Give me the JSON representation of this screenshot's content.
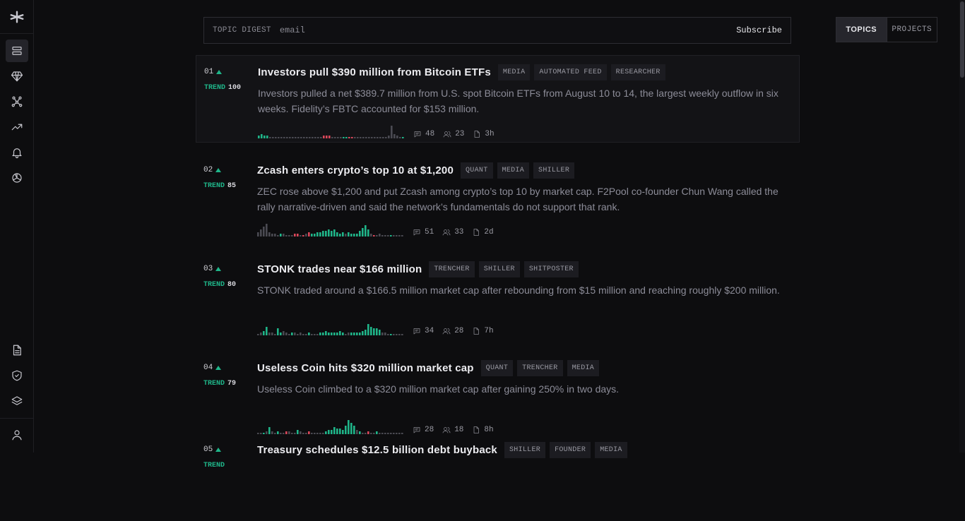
{
  "digest": {
    "label": "TOPIC DIGEST",
    "placeholder": "email",
    "button": "Subscribe"
  },
  "view_toggle": {
    "active": "TOPICS",
    "inactive": "PROJECTS"
  },
  "sidebar": {
    "top_icons": [
      "logo-icon",
      "feed-icon",
      "diamond-icon",
      "network-icon",
      "trending-icon",
      "bell-icon",
      "ai-icon"
    ],
    "bottom_icons": [
      "document-icon",
      "shield-icon",
      "layers-icon",
      "user-icon"
    ]
  },
  "topics": [
    {
      "rank": "01",
      "trend_label": "TREND",
      "trend": "100",
      "title": "Investors pull $390 million from Bitcoin ETFs",
      "tags": [
        "MEDIA",
        "AUTOMATED FEED",
        "RESEARCHER"
      ],
      "description": "Investors pulled a net $389.7 million from U.S. spot Bitcoin ETFs from August 10 to 14, the largest weekly outflow in six weeks. Fidelity’s FBTC accounted for $153 million.",
      "comments": "48",
      "users": "23",
      "age": "3h",
      "spark": [
        2,
        3,
        2,
        2,
        1,
        1,
        1,
        1,
        1,
        1,
        1,
        1,
        1,
        1,
        1,
        1,
        1,
        1,
        1,
        1,
        1,
        1,
        1,
        2,
        2,
        2,
        1,
        1,
        1,
        1,
        1,
        1,
        1,
        1,
        1,
        1,
        1,
        1,
        1,
        1,
        1,
        1,
        1,
        1,
        1,
        1,
        2,
        9,
        3,
        2,
        1,
        1
      ],
      "spark_color": [
        "g",
        "g",
        "g",
        "g",
        "n",
        "n",
        "n",
        "n",
        "n",
        "n",
        "n",
        "n",
        "n",
        "n",
        "n",
        "n",
        "n",
        "n",
        "n",
        "n",
        "n",
        "n",
        "n",
        "r",
        "r",
        "r",
        "n",
        "n",
        "n",
        "n",
        "g",
        "g",
        "r",
        "r",
        "n",
        "n",
        "n",
        "n",
        "n",
        "n",
        "n",
        "n",
        "n",
        "n",
        "n",
        "n",
        "n",
        "n",
        "n",
        "n",
        "n",
        "g"
      ]
    },
    {
      "rank": "02",
      "trend_label": "TREND",
      "trend": "85",
      "title": "Zcash enters crypto’s top 10 at $1,200",
      "tags": [
        "QUANT",
        "MEDIA",
        "SHILLER"
      ],
      "description": "ZEC rose above $1,200 and put Zcash among crypto’s top 10 by market cap. F2Pool co-founder Chun Wang called the rally narrative-driven and said the network’s fundamentals do not support that rank.",
      "comments": "51",
      "users": "33",
      "age": "2d",
      "spark": [
        3,
        5,
        7,
        9,
        3,
        2,
        2,
        1,
        2,
        2,
        1,
        1,
        1,
        2,
        2,
        1,
        1,
        2,
        3,
        2,
        2,
        3,
        3,
        4,
        4,
        5,
        4,
        5,
        3,
        2,
        3,
        2,
        3,
        2,
        2,
        2,
        4,
        6,
        8,
        5,
        2,
        1,
        1,
        2,
        1,
        1,
        1,
        1,
        1,
        1,
        1,
        1
      ],
      "spark_color": [
        "n",
        "n",
        "n",
        "n",
        "n",
        "n",
        "n",
        "n",
        "g",
        "n",
        "n",
        "n",
        "n",
        "r",
        "r",
        "n",
        "r",
        "n",
        "r",
        "g",
        "g",
        "g",
        "g",
        "g",
        "g",
        "g",
        "g",
        "g",
        "g",
        "g",
        "g",
        "n",
        "g",
        "g",
        "g",
        "g",
        "g",
        "g",
        "g",
        "g",
        "n",
        "r",
        "n",
        "n",
        "n",
        "n",
        "n",
        "g",
        "n",
        "n",
        "n",
        "n"
      ]
    },
    {
      "rank": "03",
      "trend_label": "TREND",
      "trend": "80",
      "title": "STONK trades near $166 million",
      "tags": [
        "TRENCHER",
        "SHILLER",
        "SHITPOSTER"
      ],
      "description": "STONK traded around a $166.5 million market cap after rebounding from $15 million and reaching roughly $200 million.",
      "comments": "34",
      "users": "28",
      "age": "7h",
      "spark": [
        1,
        2,
        3,
        6,
        2,
        2,
        1,
        5,
        2,
        3,
        2,
        1,
        2,
        2,
        1,
        2,
        1,
        1,
        2,
        1,
        1,
        1,
        2,
        2,
        3,
        2,
        2,
        2,
        2,
        3,
        2,
        1,
        2,
        2,
        2,
        2,
        2,
        3,
        4,
        8,
        6,
        5,
        5,
        4,
        2,
        2,
        1,
        1,
        1,
        1,
        1,
        1
      ],
      "spark_color": [
        "n",
        "n",
        "g",
        "g",
        "n",
        "n",
        "n",
        "g",
        "g",
        "n",
        "n",
        "n",
        "g",
        "n",
        "n",
        "n",
        "n",
        "n",
        "g",
        "n",
        "n",
        "n",
        "g",
        "g",
        "g",
        "g",
        "g",
        "g",
        "g",
        "g",
        "g",
        "n",
        "n",
        "g",
        "g",
        "g",
        "g",
        "g",
        "g",
        "g",
        "g",
        "g",
        "g",
        "g",
        "n",
        "n",
        "n",
        "g",
        "n",
        "n",
        "n",
        "n"
      ]
    },
    {
      "rank": "04",
      "trend_label": "TREND",
      "trend": "79",
      "title": "Useless Coin hits $320 million market cap",
      "tags": [
        "QUANT",
        "TRENCHER",
        "MEDIA"
      ],
      "description": "Useless Coin climbed to a $320 million market cap after gaining 250% in two days.",
      "comments": "28",
      "users": "18",
      "age": "8h",
      "spark": [
        1,
        1,
        1,
        2,
        5,
        2,
        1,
        2,
        1,
        1,
        2,
        2,
        1,
        1,
        3,
        2,
        1,
        1,
        2,
        1,
        1,
        1,
        1,
        1,
        2,
        3,
        3,
        5,
        4,
        4,
        3,
        6,
        10,
        8,
        6,
        3,
        2,
        1,
        1,
        2,
        1,
        1,
        2,
        1,
        1,
        1,
        1,
        1,
        1,
        1,
        1,
        1
      ],
      "spark_color": [
        "n",
        "n",
        "g",
        "n",
        "g",
        "n",
        "n",
        "g",
        "n",
        "n",
        "r",
        "n",
        "n",
        "n",
        "g",
        "n",
        "n",
        "n",
        "r",
        "n",
        "n",
        "n",
        "n",
        "n",
        "g",
        "g",
        "g",
        "g",
        "g",
        "g",
        "g",
        "g",
        "g",
        "g",
        "g",
        "n",
        "g",
        "n",
        "n",
        "r",
        "n",
        "n",
        "g",
        "n",
        "n",
        "n",
        "n",
        "n",
        "n",
        "n",
        "n",
        "n"
      ]
    },
    {
      "rank": "05",
      "trend_label": "TREND",
      "trend": "",
      "title": "Treasury schedules $12.5 billion debt buyback",
      "tags": [
        "SHILLER",
        "FOUNDER",
        "MEDIA"
      ],
      "description": "",
      "comments": "",
      "users": "",
      "age": "",
      "spark": [],
      "spark_color": []
    }
  ],
  "colors": {
    "green": "#1fb589",
    "red": "#d9475a",
    "neutral": "#4a4a52",
    "accent_bg": "#26262c"
  }
}
